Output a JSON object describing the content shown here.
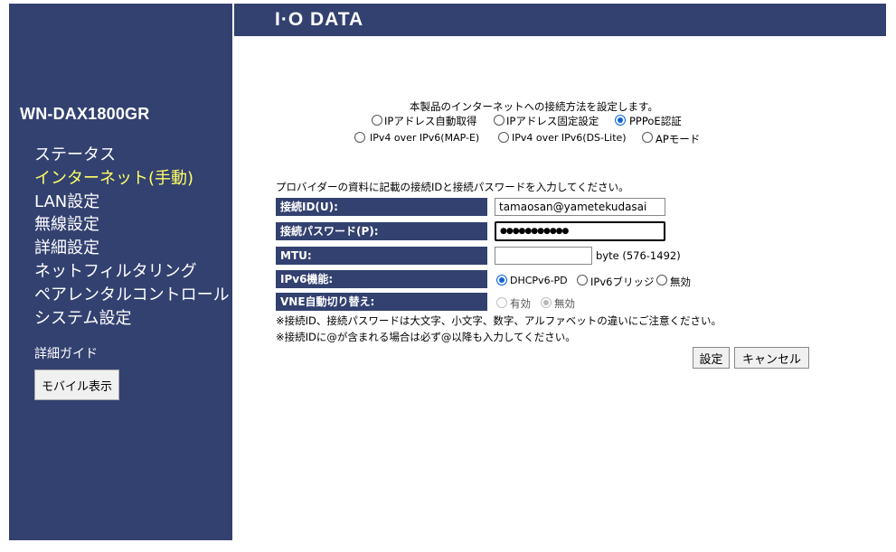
{
  "header": {
    "logo": "I·O DATA"
  },
  "sidebar": {
    "model": "WN-DAX1800GR",
    "nav": [
      {
        "label": "ステータス",
        "active": false
      },
      {
        "label": "インターネット(手動)",
        "active": true
      },
      {
        "label": "LAN設定",
        "active": false
      },
      {
        "label": "無線設定",
        "active": false
      },
      {
        "label": "詳細設定",
        "active": false
      },
      {
        "label": "ネットフィルタリング",
        "active": false
      },
      {
        "label": "ペアレンタルコントロール",
        "active": false
      },
      {
        "label": "システム設定",
        "active": false
      }
    ],
    "guide": "詳細ガイド",
    "mobile_button": "モバイル表示"
  },
  "main": {
    "intro": "本製品のインターネットへの接続方法を設定します。",
    "connection_modes": [
      {
        "label": "IPアドレス自動取得",
        "checked": false
      },
      {
        "label": "IPアドレス固定設定",
        "checked": false
      },
      {
        "label": "PPPoE認証",
        "checked": true
      },
      {
        "label": "IPv4 over IPv6(MAP-E)",
        "checked": false
      },
      {
        "label": "IPv4 over IPv6(DS-Lite)",
        "checked": false
      },
      {
        "label": "APモード",
        "checked": false
      }
    ],
    "instruction": "プロバイダーの資料に記載の接続IDと接続パスワードを入力してください。",
    "form": {
      "id_label": "接続ID(U):",
      "id_value": "tamaosan@yametekudasai",
      "password_label": "接続パスワード(P):",
      "password_value": "●●●●●●●●●●●",
      "mtu_label": "MTU:",
      "mtu_value": "",
      "mtu_hint": "byte (576-1492)",
      "ipv6_label": "IPv6機能:",
      "ipv6_options": [
        {
          "label": "DHCPv6-PD",
          "checked": true
        },
        {
          "label": "IPv6ブリッジ",
          "checked": false
        },
        {
          "label": "無効",
          "checked": false
        }
      ],
      "vne_label": "VNE自動切り替え:",
      "vne_options": [
        {
          "label": "有効",
          "checked": false
        },
        {
          "label": "無効",
          "checked": true
        }
      ]
    },
    "notes": [
      "※接続ID、接続パスワードは大文字、小文字、数字、アルファベットの違いにご注意ください。",
      "※接続IDに@が含まれる場合は必ず@以降も入力してください。"
    ],
    "buttons": {
      "apply": "設定",
      "cancel": "キャンセル"
    }
  }
}
